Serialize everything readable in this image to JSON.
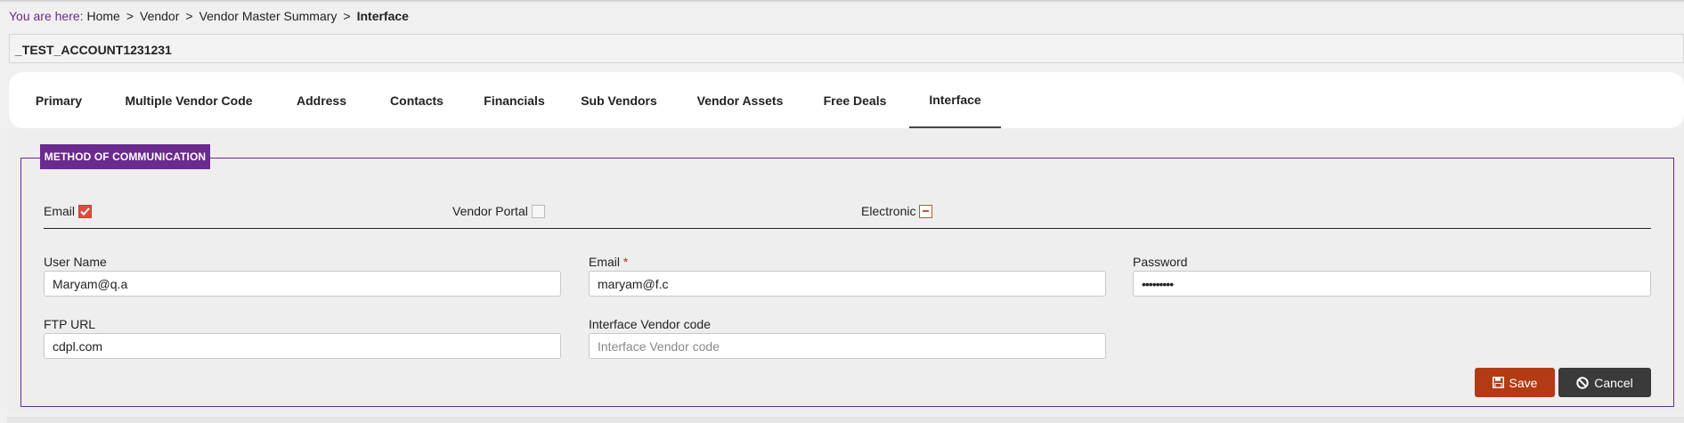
{
  "breadcrumb": {
    "prefix": "You are here:",
    "items": [
      "Home",
      "Vendor",
      "Vendor Master Summary"
    ],
    "current": "Interface",
    "separator": ">"
  },
  "account": {
    "name": "_TEST_ACCOUNT1231231"
  },
  "tabs": [
    {
      "label": "Primary"
    },
    {
      "label": "Multiple Vendor Code"
    },
    {
      "label": "Address"
    },
    {
      "label": "Contacts"
    },
    {
      "label": "Financials"
    },
    {
      "label": "Sub Vendors"
    },
    {
      "label": "Vendor Assets"
    },
    {
      "label": "Free Deals"
    },
    {
      "label": "Interface"
    }
  ],
  "active_tab": "Interface",
  "section": {
    "title": "METHOD OF COMMUNICATION"
  },
  "methods": {
    "email": {
      "label": "Email",
      "state": "checked"
    },
    "vendor_portal": {
      "label": "Vendor Portal",
      "state": "unchecked"
    },
    "electronic": {
      "label": "Electronic",
      "state": "indeterminate"
    }
  },
  "form": {
    "user_name": {
      "label": "User Name",
      "value": "Maryam@q.a",
      "placeholder": ""
    },
    "email": {
      "label": "Email",
      "required_mark": "*",
      "value": "maryam@f.c",
      "placeholder": ""
    },
    "password": {
      "label": "Password",
      "value": "•••••••••",
      "placeholder": ""
    },
    "ftp_url": {
      "label": "FTP URL",
      "value": "cdpl.com",
      "placeholder": ""
    },
    "interface_vendor_code": {
      "label": "Interface Vendor code",
      "value": "",
      "placeholder": "Interface Vendor code"
    }
  },
  "actions": {
    "save_label": "Save",
    "cancel_label": "Cancel"
  },
  "colors": {
    "accent": "#6b2a8e",
    "save": "#b23b16",
    "cancel": "#3a3a3a",
    "checkbox_checked": "#e34b3c",
    "required": "#dd2222"
  },
  "icons": {
    "save": "floppy-disk-icon",
    "cancel": "ban-icon",
    "checked": "check-icon",
    "indeterminate": "minus-icon"
  }
}
